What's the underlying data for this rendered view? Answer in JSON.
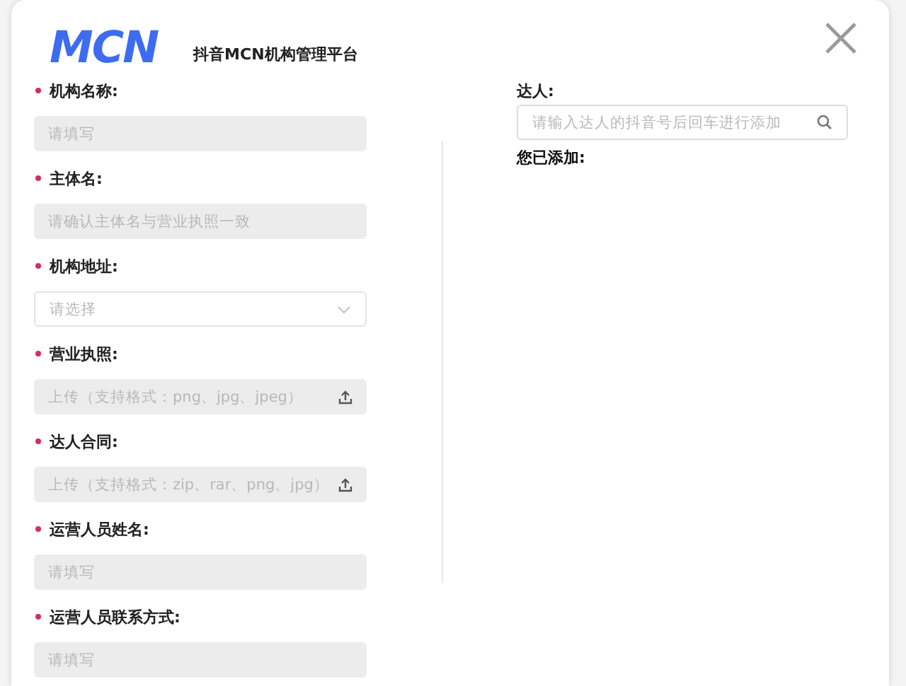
{
  "header": {
    "logo": "MCN",
    "title": "抖音MCN机构管理平台"
  },
  "form": {
    "fields": [
      {
        "label": "机构名称:",
        "required": true,
        "kind": "text",
        "placeholder": "请填写"
      },
      {
        "label": "主体名:",
        "required": true,
        "kind": "text",
        "placeholder": "请确认主体名与营业执照一致"
      },
      {
        "label": "机构地址:",
        "required": true,
        "kind": "select",
        "placeholder": "请选择"
      },
      {
        "label": "营业执照:",
        "required": true,
        "kind": "upload",
        "placeholder": "上传（支持格式：png、jpg、jpeg）"
      },
      {
        "label": "达人合同:",
        "required": true,
        "kind": "upload",
        "placeholder": "上传（支持格式：zip、rar、png、jpg）"
      },
      {
        "label": "运营人员姓名:",
        "required": true,
        "kind": "text",
        "placeholder": "请填写"
      },
      {
        "label": "运营人员联系方式:",
        "required": true,
        "kind": "text",
        "placeholder": "请填写"
      }
    ]
  },
  "talent": {
    "label": "达人:",
    "search": {
      "placeholder": "请输入达人的抖音号后回车进行添加"
    },
    "added_label": "您已添加:"
  }
}
